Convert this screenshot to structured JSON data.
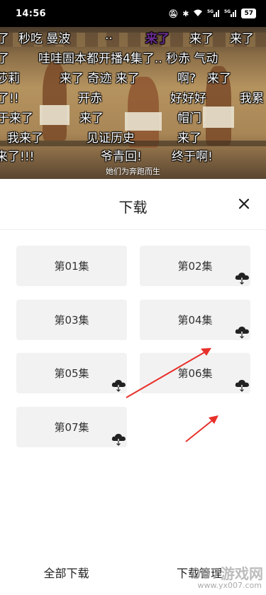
{
  "status_bar": {
    "time": "14:56",
    "icons": [
      "mute-icon",
      "bluetooth-icon",
      "wifi-icon",
      "signal-5g-icon",
      "signal-5g-icon"
    ],
    "signal_labels": [
      "5G",
      "5G"
    ],
    "battery": "57"
  },
  "video": {
    "danmaku": [
      [
        "了",
        "秒吃 曼波",
        "..",
        "来了",
        "来了",
        "来了"
      ],
      [
        "了",
        "哇哇圄本都开播4集了.. 秒赤 气动"
      ],
      [
        "莎莉",
        "来了 奇迹 来了",
        "啊?",
        "来了"
      ],
      [
        "了!!",
        "开赤",
        "好好好",
        "我累"
      ],
      [
        "于来了",
        "来了",
        "帽门"
      ],
      [
        "我来了",
        "见证历史",
        "来了"
      ],
      [
        "来了!!!",
        "爷青回!",
        "终于啊!"
      ]
    ],
    "subtitle": "她们为奔跑而生"
  },
  "sheet": {
    "title": "下载",
    "close_icon": "close-icon"
  },
  "episodes": [
    {
      "label": "第01集",
      "downloadable": false
    },
    {
      "label": "第02集",
      "downloadable": true
    },
    {
      "label": "第03集",
      "downloadable": false
    },
    {
      "label": "第04集",
      "downloadable": true
    },
    {
      "label": "第05集",
      "downloadable": true
    },
    {
      "label": "第06集",
      "downloadable": true
    },
    {
      "label": "第07集",
      "downloadable": true
    }
  ],
  "footer": {
    "download_all": "全部下载",
    "download_manage": "下载管理"
  },
  "watermark": {
    "text": "007游戏网",
    "url": "www.yx007.com"
  },
  "colors": {
    "arrow": "#e8302a",
    "tile_bg": "#f2f2f2",
    "danmaku_highlight": "#6a2c91"
  }
}
